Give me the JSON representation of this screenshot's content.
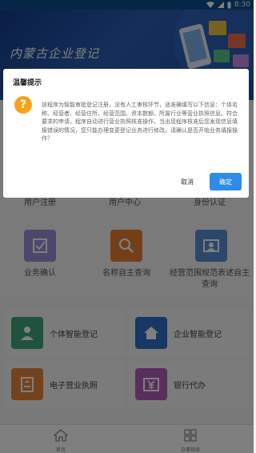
{
  "status_bar": {
    "time": "8:30"
  },
  "banner": {
    "title": "内蒙古企业登记"
  },
  "menu": {
    "row1": [
      {
        "label": "用户注册",
        "icon": "user-add-icon"
      },
      {
        "label": "用户中心",
        "icon": "user-center-icon"
      },
      {
        "label": "身份认证",
        "icon": "id-card-icon"
      }
    ],
    "row2": [
      {
        "label": "业务确认",
        "icon": "checkbox-icon",
        "color": "#9b8ed8"
      },
      {
        "label": "名称自主查询",
        "icon": "magnifier-icon",
        "color": "#e97e2e"
      },
      {
        "label": "经营范围规范表述自主查询",
        "icon": "id-photo-icon",
        "color": "#5b8fd6"
      }
    ]
  },
  "cards": [
    {
      "label": "个体智能登记",
      "icon": "person-icon",
      "color": "#3ea77a"
    },
    {
      "label": "企业智能登记",
      "icon": "home-icon",
      "color": "#2f6fc9"
    },
    {
      "label": "电子营业执照",
      "icon": "license-icon",
      "color": "#e6873a"
    },
    {
      "label": "银行代办",
      "icon": "yuan-icon",
      "color": "#b15fb8"
    }
  ],
  "tabbar": {
    "tabs": [
      {
        "label": "首页",
        "icon": "home-outline-icon"
      },
      {
        "label": "办事指南",
        "icon": "grid-icon"
      }
    ]
  },
  "dialog": {
    "title": "温馨提示",
    "icon": "question-icon",
    "message": "该程序为智能审批登记注册，没有人工审核环节，适准确填写以下信息：个体名称、经营者、经营住所、经营范围、资本数额、所属行业等营业执照信息。符合要求的申请，程序自动进行营业执照核准操作，当出现程序核准后您发现信息填报错误的情况，您只能办理变更登记业务进行修改。请确认是否开始业务填报操作？",
    "cancel_label": "取消",
    "confirm_label": "确定",
    "confirm_color": "#2e8ce8"
  }
}
